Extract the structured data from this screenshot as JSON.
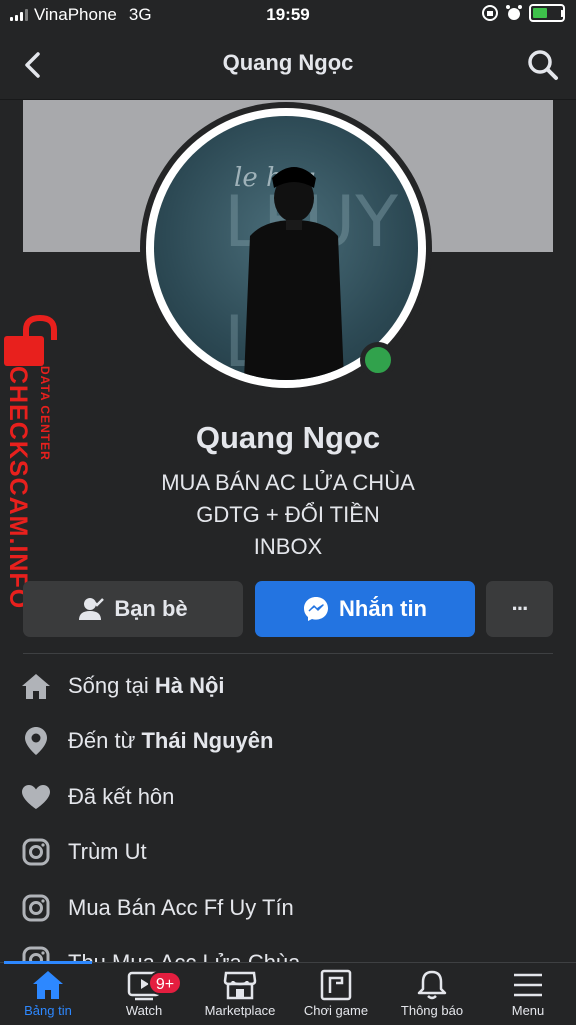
{
  "status_bar": {
    "carrier": "VinaPhone",
    "network": "3G",
    "time": "19:59"
  },
  "header": {
    "title": "Quang Ngọc"
  },
  "profile": {
    "name": "Quang Ngọc",
    "bio_lines": [
      "MUA BÁN AC LỬA CHÙA",
      "GDTG + ĐỔI TIỀN",
      "INBOX"
    ],
    "online": true
  },
  "watermark": {
    "main": "CHECKSCAM.INFO",
    "sub": "DATA CENTER",
    "color": "#e8201d"
  },
  "actions": {
    "friends_label": "Bạn bè",
    "message_label": "Nhắn tin",
    "more_label": "···"
  },
  "info": [
    {
      "icon": "home-icon",
      "prefix": "Sống tại ",
      "value": "Hà Nội"
    },
    {
      "icon": "location-pin-icon",
      "prefix": "Đến từ ",
      "value": "Thái Nguyên"
    },
    {
      "icon": "heart-icon",
      "prefix": "Đã kết hôn",
      "value": ""
    },
    {
      "icon": "instagram-icon",
      "prefix": "Trùm Ut",
      "value": ""
    },
    {
      "icon": "instagram-icon",
      "prefix": "Mua Bán Acc Ff Uy Tín",
      "value": ""
    },
    {
      "icon": "instagram-icon",
      "prefix": "Thu Mua Acc Lửa Chùa",
      "value": ""
    }
  ],
  "tabs": [
    {
      "label": "Bảng tin",
      "icon": "home-icon",
      "active": true
    },
    {
      "label": "Watch",
      "icon": "watch-icon",
      "badge": "9+"
    },
    {
      "label": "Marketplace",
      "icon": "marketplace-icon"
    },
    {
      "label": "Chơi game",
      "icon": "gaming-icon"
    },
    {
      "label": "Thông báo",
      "icon": "bell-icon"
    },
    {
      "label": "Menu",
      "icon": "menu-icon"
    }
  ],
  "colors": {
    "background": "#242526",
    "accent": "#2374e1",
    "online": "#31a24c"
  }
}
